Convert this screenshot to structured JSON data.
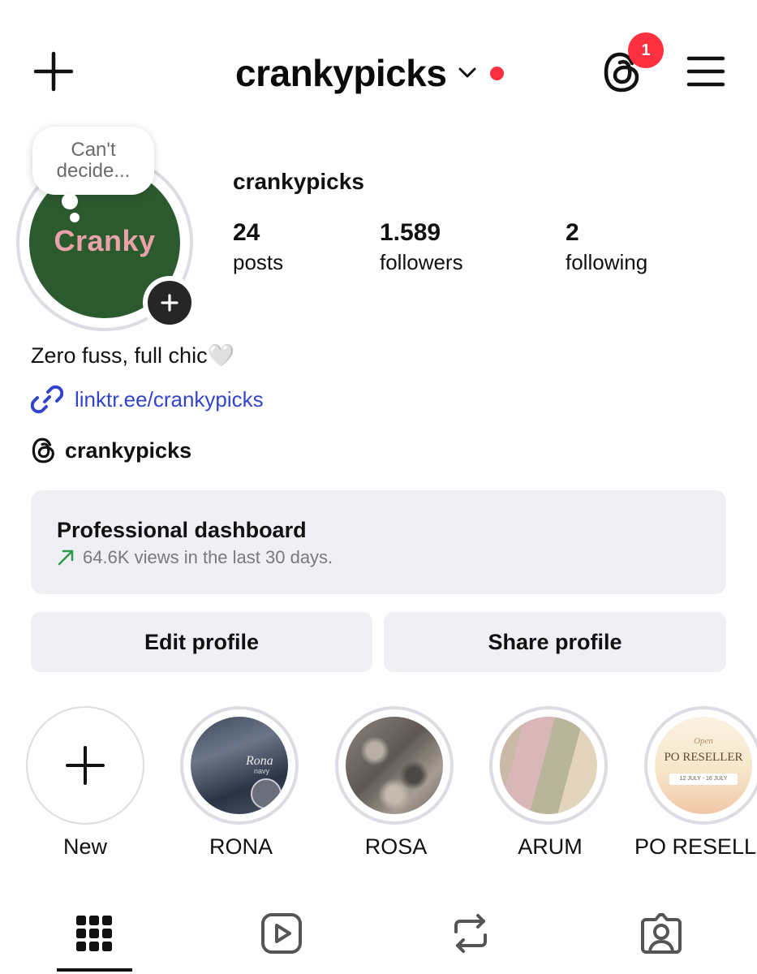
{
  "header": {
    "username": "crankypicks",
    "notification_count": "1",
    "colors": {
      "badge": "#ff3040",
      "dot": "#ff3040"
    }
  },
  "profile": {
    "note": "Can't decide...",
    "avatar_logo": "Cranky",
    "name": "crankypicks",
    "stats": [
      {
        "value": "24",
        "label": "posts"
      },
      {
        "value": "1.589",
        "label": "followers"
      },
      {
        "value": "2",
        "label": "following"
      }
    ],
    "bio": "Zero fuss, full chic🤍",
    "link": "linktr.ee/crankypicks",
    "threads_handle": "crankypicks"
  },
  "dashboard": {
    "title": "Professional dashboard",
    "subtitle": "64.6K views in the last 30 days."
  },
  "actions": {
    "edit_label": "Edit profile",
    "share_label": "Share profile"
  },
  "highlights": [
    {
      "label": "New",
      "icon": "plus-icon"
    },
    {
      "label": "RONA",
      "image_text": "Rona",
      "image_subtext": "navy"
    },
    {
      "label": "ROSA"
    },
    {
      "label": "ARUM"
    },
    {
      "label": "PO RESELL...",
      "image_text": "PO RESELLER",
      "image_top": "Open",
      "image_bottom": "12 JULY - 16 JULY"
    }
  ],
  "tabs": [
    "grid-icon",
    "reels-icon",
    "reposts-icon",
    "tagged-icon"
  ]
}
